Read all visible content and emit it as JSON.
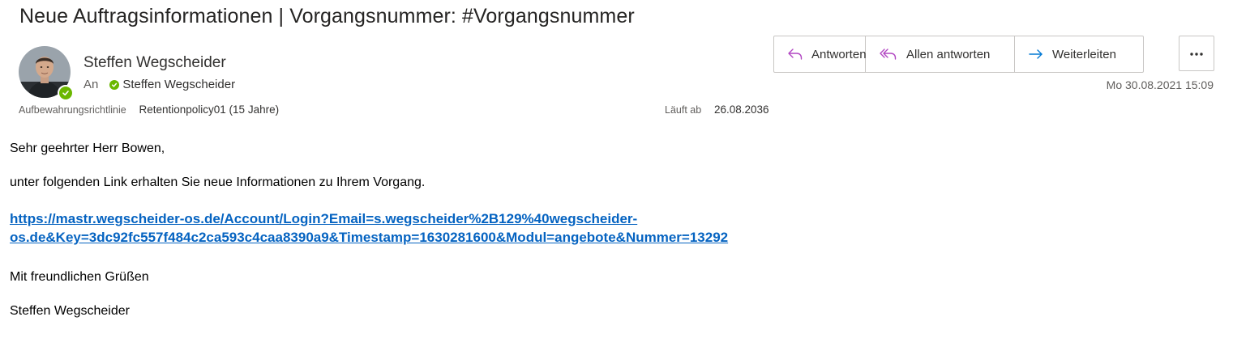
{
  "email": {
    "subject": "Neue Auftragsinformationen | Vorgangsnummer: #Vorgangsnummer",
    "sender": {
      "name": "Steffen Wegscheider",
      "presence": "available",
      "presence_color": "#6bb700"
    },
    "recipients": {
      "label": "An",
      "to": "Steffen Wegscheider"
    },
    "retention": {
      "label": "Aufbewahrungsrichtlinie",
      "value": "Retentionpolicy01 (15 Jahre)",
      "expires_label": "Läuft ab",
      "expires_value": "26.08.2036"
    },
    "date": "Mo 30.08.2021 15:09",
    "body": {
      "greeting": "Sehr geehrter Herr Bowen,",
      "intro": "unter folgenden Link erhalten Sie neue Informationen zu Ihrem Vorgang.",
      "link_line1": "https://mastr.wegscheider-os.de/Account/Login?Email=s.wegscheider%2B129%40wegscheider-",
      "link_line2": "os.de&Key=3dc92fc557f484c2ca593c4caa8390a9&Timestamp=1630281600&Modul=angebote&Nummer=13292",
      "closing": "Mit freundlichen Grüßen",
      "signature": "Steffen Wegscheider"
    }
  },
  "actions": {
    "reply": {
      "label": "Antworten",
      "icon": "reply-icon"
    },
    "reply_all": {
      "label": "Allen antworten",
      "icon": "reply-all-icon"
    },
    "forward": {
      "label": "Weiterleiten",
      "icon": "forward-arrow-icon"
    },
    "more": {
      "icon": "more-options-icon"
    }
  },
  "colors": {
    "reply_icon": "#b146c2",
    "forward_icon": "#0078d4",
    "link": "#0563c1"
  }
}
